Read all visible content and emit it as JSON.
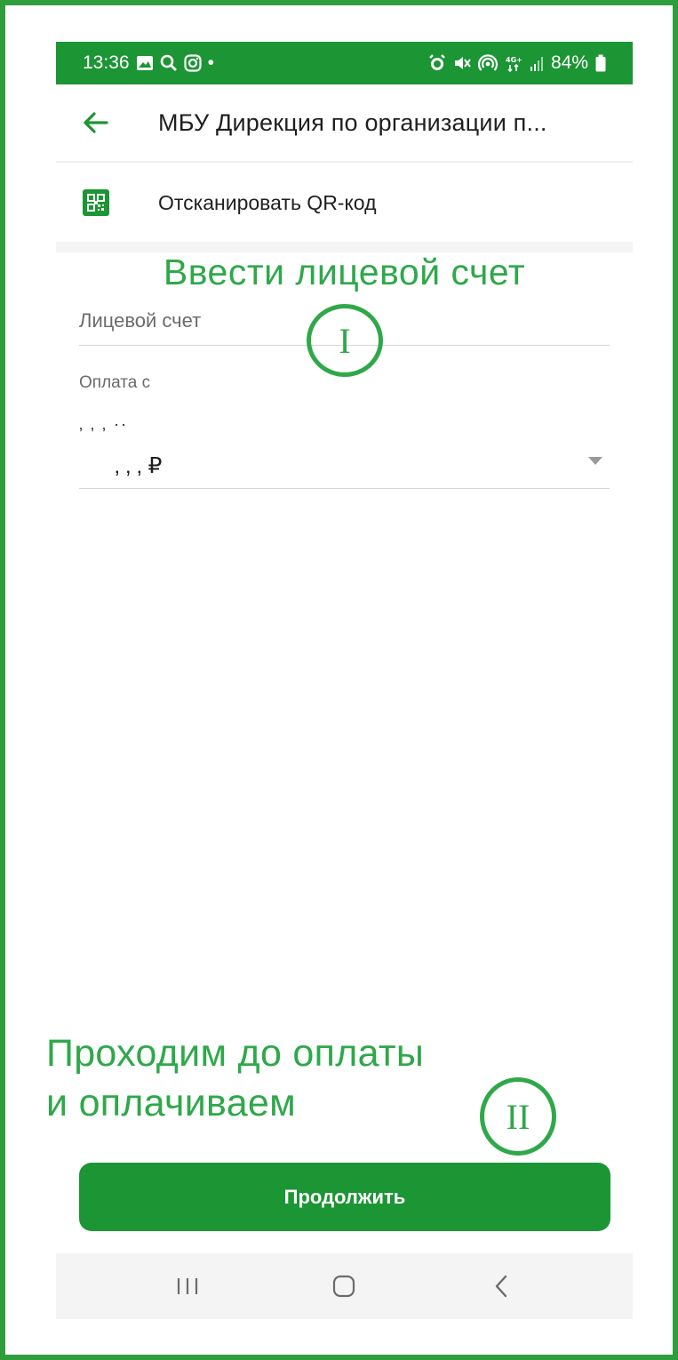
{
  "status_bar": {
    "time": "13:36",
    "battery": "84%",
    "dot": "•",
    "left_icons": [
      "image-icon",
      "search-icon",
      "instagram-icon"
    ],
    "right_icons": [
      "alarm-icon",
      "mute-icon",
      "hotspot-icon",
      "4g-icon",
      "signal-icon",
      "battery-icon"
    ],
    "network": "4G+"
  },
  "app_bar": {
    "title": "МБУ Дирекция по организации п..."
  },
  "qr_row": {
    "label": "Отсканировать QR-код"
  },
  "annotations": {
    "step1_text": "Ввести лицевой счет",
    "step1_marker": "I",
    "step2_line1": "Проходим до оплаты",
    "step2_line2": "и оплачиваем",
    "step2_marker": "II"
  },
  "form": {
    "account_placeholder": "Лицевой счет",
    "pay_from_label": "Оплата с",
    "account_line1": "‚ ‚ ‚  ··",
    "account_balance": "‚ ‚ ‚ ₽"
  },
  "buttons": {
    "continue": "Продолжить"
  },
  "colors": {
    "brand_green": "#1c9534",
    "annotation_green": "#2fa84a",
    "frame_green": "#2e9d3c"
  }
}
